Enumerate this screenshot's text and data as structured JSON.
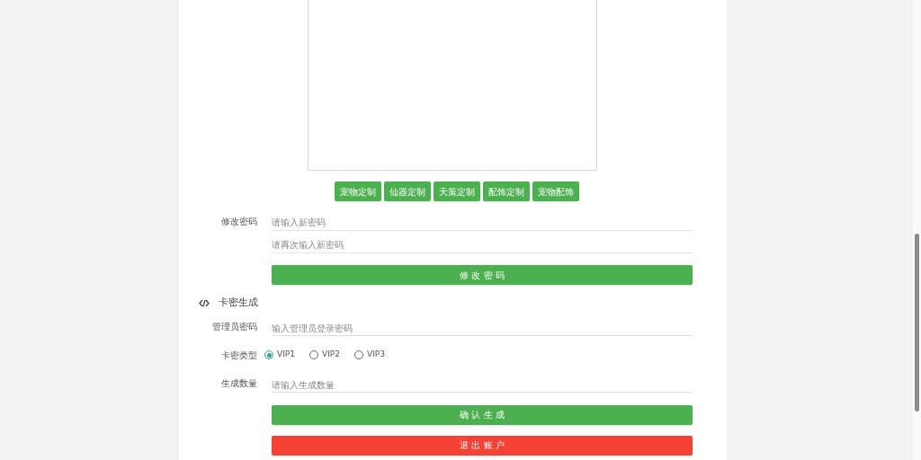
{
  "custom_buttons": [
    "宠物定制",
    "仙器定制",
    "天策定制",
    "配饰定制",
    "宠物配饰"
  ],
  "password": {
    "label": "修改密码",
    "fields": [
      {
        "placeholder": "请输入新密码"
      },
      {
        "placeholder": "请再次输入新密码"
      }
    ],
    "button": "修 改 密 码"
  },
  "card_section": {
    "title": "卡密生成",
    "admin": {
      "label": "管理员密码",
      "placeholder": "输入管理员登录密码"
    },
    "type": {
      "label": "卡密类型",
      "options": [
        {
          "label": "VIP1",
          "selected": true
        },
        {
          "label": "VIP2",
          "selected": false
        },
        {
          "label": "VIP3",
          "selected": false
        }
      ]
    },
    "count": {
      "label": "生成数量",
      "placeholder": "请输入生成数量"
    },
    "confirm": "确 认 生 成",
    "logout": "退 出 账 户"
  }
}
